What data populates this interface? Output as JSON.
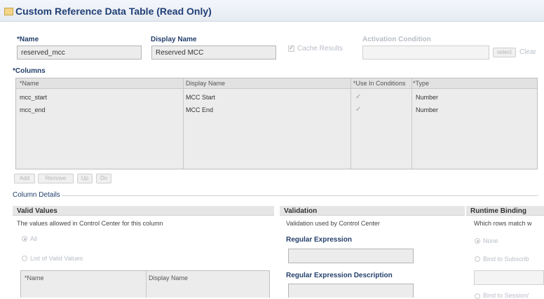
{
  "title": "Custom Reference Data Table (Read Only)",
  "name": {
    "label": "*Name",
    "value": "reserved_mcc"
  },
  "display_name": {
    "label": "Display Name",
    "value": "Reserved MCC"
  },
  "cache_results": {
    "label": "Cache Results",
    "checked": true
  },
  "activation": {
    "label": "Activation Condition",
    "value": "",
    "select_label": "select",
    "clear_label": "Clear"
  },
  "columns": {
    "label": "*Columns",
    "headers": [
      "*Name",
      "Display Name",
      "*Use In Conditions",
      "*Type"
    ],
    "rows": [
      {
        "name": "mcc_start",
        "display": "MCC Start",
        "use": "✓",
        "type": "Number"
      },
      {
        "name": "mcc_end",
        "display": "MCC End",
        "use": "✓",
        "type": "Number"
      }
    ],
    "buttons": {
      "add": "Add",
      "remove": "Remove",
      "up": "Up",
      "down": "Dn"
    }
  },
  "column_details": {
    "label": "Column Details"
  },
  "valid_values": {
    "heading": "Valid Values",
    "desc": "The values allowed in Control Center for this column",
    "all": "All",
    "list": "List of Valid Values",
    "table_headers": [
      "*Name",
      "Display Name"
    ]
  },
  "validation": {
    "heading": "Validation",
    "desc": "Validation used by Control Center",
    "regex_label": "Regular Expression",
    "regex_desc_label": "Regular Expression Description"
  },
  "runtime": {
    "heading": "Runtime Binding",
    "desc": "Which rows match w",
    "none": "None",
    "bind_subscriber": "Bind to Subscrib",
    "bind_session": "Bind to Session/"
  }
}
